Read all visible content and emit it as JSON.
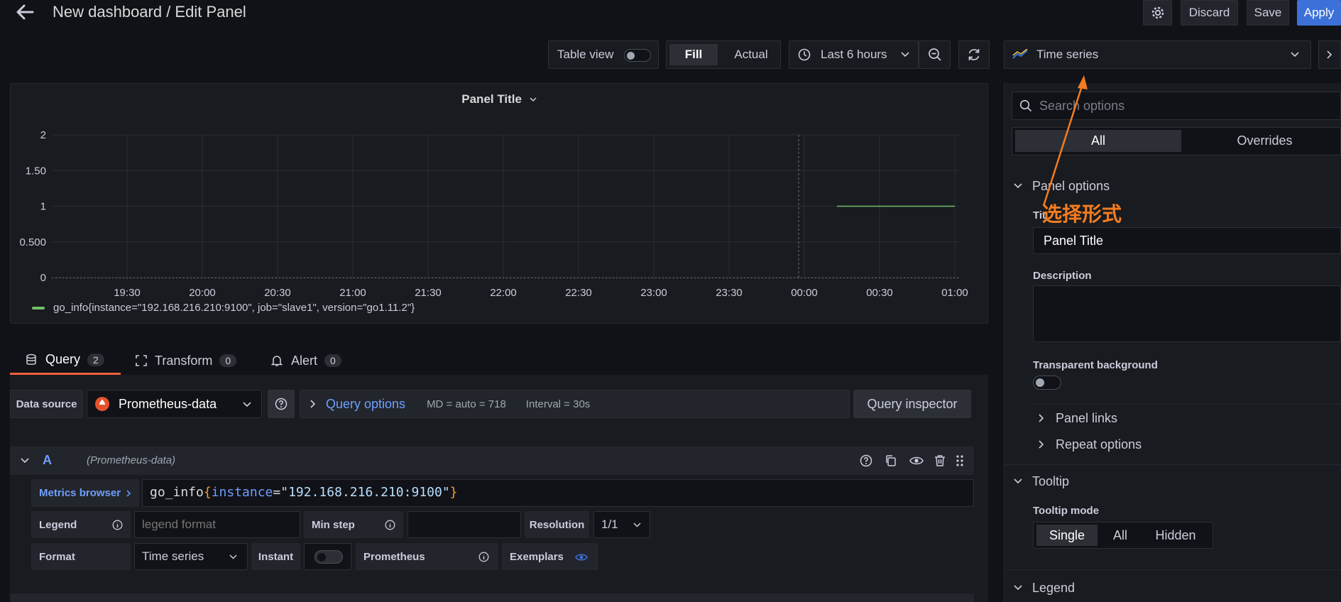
{
  "header": {
    "title": "New dashboard / Edit Panel",
    "discard_label": "Discard",
    "save_label": "Save",
    "apply_label": "Apply"
  },
  "toolbar": {
    "table_view_label": "Table view",
    "fill_label": "Fill",
    "actual_label": "Actual",
    "time_range_label": "Last 6 hours",
    "visualization_label": "Time series"
  },
  "panel": {
    "title": "Panel Title",
    "legend_entry": "go_info{instance=\"192.168.216.210:9100\", job=\"slave1\", version=\"go1.11.2\"}"
  },
  "chart_data": {
    "type": "line",
    "x": [
      "19:30",
      "20:00",
      "20:30",
      "21:00",
      "21:30",
      "22:00",
      "22:30",
      "23:00",
      "23:30",
      "00:00",
      "00:30",
      "01:00"
    ],
    "y_ticks": [
      "0",
      "0.500",
      "1",
      "1.50",
      "2"
    ],
    "ylim": [
      0,
      2
    ],
    "series": [
      {
        "name": "go_info{instance=\"192.168.216.210:9100\", job=\"slave1\", version=\"go1.11.2\"}",
        "x_start": "00:13",
        "x_end": "01:00",
        "value": 1,
        "color": "#73bf69"
      }
    ],
    "grid": true,
    "legend_position": "bottom"
  },
  "tabs": [
    {
      "label": "Query",
      "count": "2"
    },
    {
      "label": "Transform",
      "count": "0"
    },
    {
      "label": "Alert",
      "count": "0"
    }
  ],
  "query_bar": {
    "data_source_label": "Data source",
    "data_source_value": "Prometheus-data",
    "query_options_label": "Query options",
    "md_text": "MD = auto = 718",
    "interval_text": "Interval = 30s",
    "inspector_label": "Query inspector"
  },
  "query_a": {
    "ref": "A",
    "source": "(Prometheus-data)",
    "metrics_browser_label": "Metrics browser",
    "expr_metric": "go_info",
    "expr_open": "{",
    "expr_key": "instance",
    "expr_eq": "=",
    "expr_value": "\"192.168.216.210:9100\"",
    "expr_close": "}",
    "legend_label": "Legend",
    "legend_placeholder": "legend format",
    "min_step_label": "Min step",
    "resolution_label": "Resolution",
    "resolution_value": "1/1",
    "format_label": "Format",
    "format_value": "Time series",
    "instant_label": "Instant",
    "prometheus_label": "Prometheus",
    "exemplars_label": "Exemplars"
  },
  "options": {
    "search_placeholder": "Search options",
    "all_tab": "All",
    "overrides_tab": "Overrides",
    "panel_options_header": "Panel options",
    "title_label_fragment": "Tit",
    "title_value": "Panel Title",
    "description_label": "Description",
    "transparent_label": "Transparent background",
    "panel_links_label": "Panel links",
    "repeat_options_label": "Repeat options",
    "tooltip_header": "Tooltip",
    "tooltip_mode_label": "Tooltip mode",
    "tooltip_modes": [
      "Single",
      "All",
      "Hidden"
    ],
    "legend_header": "Legend"
  },
  "annotation": {
    "text": "选择形式",
    "color": "#f47c20"
  },
  "colors": {
    "background": "#111217",
    "panel": "#181b1f",
    "accent_blue": "#3d71d9",
    "series_green": "#73bf69",
    "tab_underline": "#f55f3e"
  }
}
